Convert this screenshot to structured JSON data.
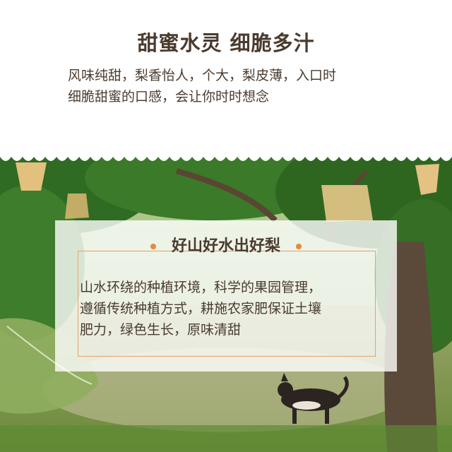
{
  "header": {
    "headline": "甜蜜水灵 细脆多汁",
    "description_lines": [
      "风味纯甜，梨香怡人，个大，梨皮薄，入口时",
      "细脆甜蜜的口感，会让你时时想念"
    ]
  },
  "card": {
    "title": "好山好水出好梨",
    "body_lines": [
      "山水环绕的种植环境，科学的果园管理，",
      "遵循传统种植方式，耕施农家肥保证土壤",
      "肥力，绿色生长，原味清甜"
    ]
  },
  "colors": {
    "text": "#4a3b2f",
    "accent": "#e38b3c",
    "frame": "#e3a46c",
    "leaf": "#3f7a2a",
    "ground": "#6e8a3e"
  }
}
